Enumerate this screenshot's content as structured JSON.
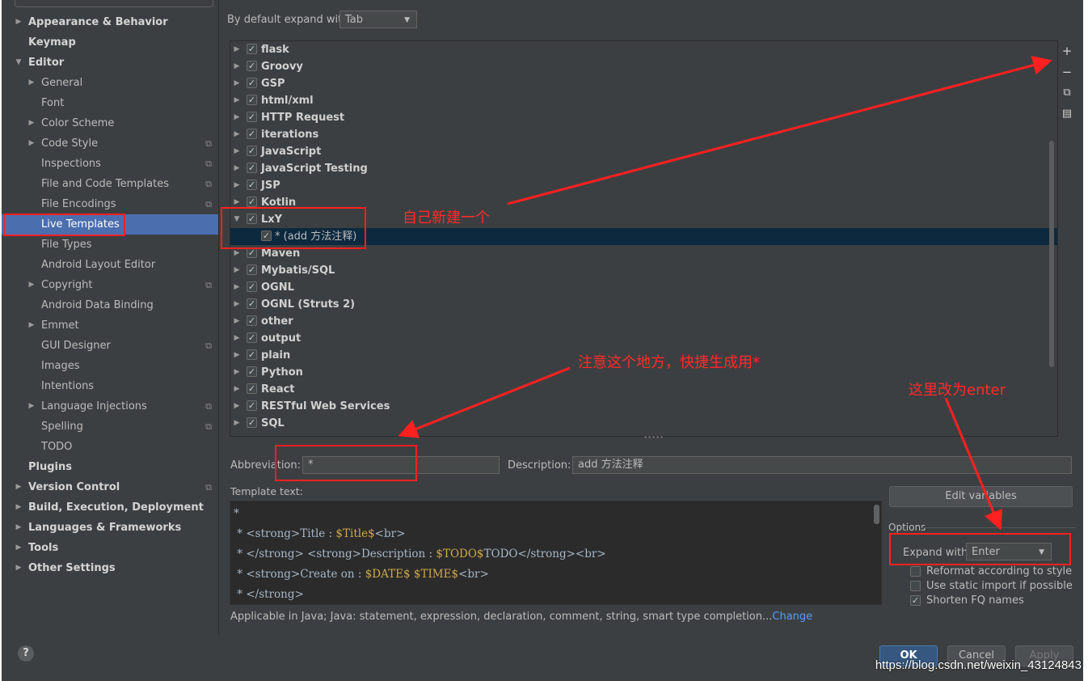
{
  "sidebar": {
    "items": [
      {
        "label": "Appearance & Behavior",
        "arrow": "▶",
        "bold": true,
        "copy": false
      },
      {
        "label": "Keymap",
        "arrow": "",
        "bold": true,
        "copy": false
      },
      {
        "label": "Editor",
        "arrow": "▼",
        "bold": true,
        "copy": false
      },
      {
        "label": "General",
        "arrow": "▶",
        "bold": false,
        "copy": false
      },
      {
        "label": "Font",
        "arrow": "",
        "bold": false,
        "copy": false
      },
      {
        "label": "Color Scheme",
        "arrow": "▶",
        "bold": false,
        "copy": false
      },
      {
        "label": "Code Style",
        "arrow": "▶",
        "bold": false,
        "copy": true
      },
      {
        "label": "Inspections",
        "arrow": "",
        "bold": false,
        "copy": true
      },
      {
        "label": "File and Code Templates",
        "arrow": "",
        "bold": false,
        "copy": true
      },
      {
        "label": "File Encodings",
        "arrow": "",
        "bold": false,
        "copy": true
      },
      {
        "label": "Live Templates",
        "arrow": "",
        "bold": false,
        "copy": false,
        "selected": true
      },
      {
        "label": "File Types",
        "arrow": "",
        "bold": false,
        "copy": false
      },
      {
        "label": "Android Layout Editor",
        "arrow": "",
        "bold": false,
        "copy": false
      },
      {
        "label": "Copyright",
        "arrow": "▶",
        "bold": false,
        "copy": true
      },
      {
        "label": "Android Data Binding",
        "arrow": "",
        "bold": false,
        "copy": false
      },
      {
        "label": "Emmet",
        "arrow": "▶",
        "bold": false,
        "copy": false
      },
      {
        "label": "GUI Designer",
        "arrow": "",
        "bold": false,
        "copy": true
      },
      {
        "label": "Images",
        "arrow": "",
        "bold": false,
        "copy": false
      },
      {
        "label": "Intentions",
        "arrow": "",
        "bold": false,
        "copy": false
      },
      {
        "label": "Language Injections",
        "arrow": "▶",
        "bold": false,
        "copy": true
      },
      {
        "label": "Spelling",
        "arrow": "",
        "bold": false,
        "copy": true
      },
      {
        "label": "TODO",
        "arrow": "",
        "bold": false,
        "copy": false
      },
      {
        "label": "Plugins",
        "arrow": "",
        "bold": true,
        "copy": false
      },
      {
        "label": "Version Control",
        "arrow": "▶",
        "bold": true,
        "copy": true
      },
      {
        "label": "Build, Execution, Deployment",
        "arrow": "▶",
        "bold": true,
        "copy": false
      },
      {
        "label": "Languages & Frameworks",
        "arrow": "▶",
        "bold": true,
        "copy": false
      },
      {
        "label": "Tools",
        "arrow": "▶",
        "bold": true,
        "copy": false
      },
      {
        "label": "Other Settings",
        "arrow": "▶",
        "bold": true,
        "copy": false
      }
    ]
  },
  "top": {
    "expand_label": "By default expand with",
    "expand_value": "Tab"
  },
  "tree": {
    "groups": [
      {
        "name": "flask",
        "tw": "▶"
      },
      {
        "name": "Groovy",
        "tw": "▶"
      },
      {
        "name": "GSP",
        "tw": "▶"
      },
      {
        "name": "html/xml",
        "tw": "▶"
      },
      {
        "name": "HTTP Request",
        "tw": "▶"
      },
      {
        "name": "iterations",
        "tw": "▶"
      },
      {
        "name": "JavaScript",
        "tw": "▶"
      },
      {
        "name": "JavaScript Testing",
        "tw": "▶"
      },
      {
        "name": "JSP",
        "tw": "▶"
      },
      {
        "name": "Kotlin",
        "tw": "▶"
      },
      {
        "name": "LxY",
        "tw": "▼"
      },
      {
        "name": "* (add 方法注释)",
        "tw": "",
        "child": true
      },
      {
        "name": "Maven",
        "tw": "▶"
      },
      {
        "name": "Mybatis/SQL",
        "tw": "▶"
      },
      {
        "name": "OGNL",
        "tw": "▶"
      },
      {
        "name": "OGNL (Struts 2)",
        "tw": "▶"
      },
      {
        "name": "other",
        "tw": "▶"
      },
      {
        "name": "output",
        "tw": "▶"
      },
      {
        "name": "plain",
        "tw": "▶"
      },
      {
        "name": "Python",
        "tw": "▶"
      },
      {
        "name": "React",
        "tw": "▶"
      },
      {
        "name": "RESTful Web Services",
        "tw": "▶"
      },
      {
        "name": "SQL",
        "tw": "▶"
      }
    ],
    "tools": [
      "+",
      "−",
      "⧉",
      "▤"
    ]
  },
  "details": {
    "abbrev_label": "Abbreviation:",
    "abbrev_value": "*",
    "desc_label": "Description:",
    "desc_value": "add 方法注释",
    "template_label": "Template text:",
    "edit_vars": "Edit variables",
    "code_lines": [
      {
        "pre": "*",
        "var": "",
        "post": ""
      },
      {
        "pre": " * <strong>Title : ",
        "var": "$Title$",
        "post": "<br>"
      },
      {
        "pre": " * </strong> <strong>Description : ",
        "var": "$TODO$",
        "post": "TODO</strong><br>"
      },
      {
        "pre": " * <strong>Create on : ",
        "var": "$DATE$ $TIME$",
        "post": "<br>"
      },
      {
        "pre": " * </strong>",
        "var": "",
        "post": ""
      }
    ],
    "applicable": "Applicable in Java; Java: statement, expression, declaration, comment, string, smart type completion...",
    "change_link": "Change",
    "options_label": "Options",
    "expand_with_label": "Expand with",
    "expand_with_value": "Enter",
    "opt_reformat": "Reformat according to style",
    "opt_static": "Use static import if possible",
    "opt_fq": "Shorten FQ names",
    "check": "✓"
  },
  "footer": {
    "help": "?",
    "ok": "OK",
    "cancel": "Cancel",
    "apply": "Apply"
  },
  "annotations": {
    "new_one": "自己新建一个",
    "note_here": "注意这个地方，快捷生成用*",
    "change_enter": "这里改为enter",
    "watermark": "https://blog.csdn.net/weixin_43124843",
    "color": "#ff2020"
  }
}
